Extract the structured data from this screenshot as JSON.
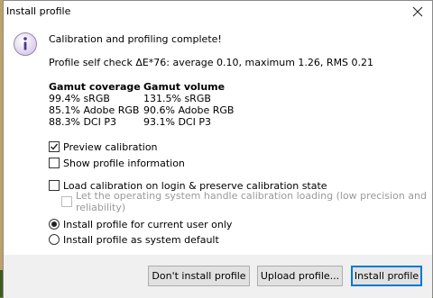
{
  "window": {
    "title": "Install profile"
  },
  "icons": {
    "info": "info-icon",
    "close": "close-icon"
  },
  "message": {
    "headline": "Calibration and profiling complete!",
    "self_check": "Profile self check ΔE*76: average 0.10, maximum 1.26, RMS 0.21"
  },
  "gamut": {
    "coverage": {
      "label": "Gamut coverage",
      "items": [
        "99.4% sRGB",
        "85.1% Adobe RGB",
        "88.3% DCI P3"
      ]
    },
    "volume": {
      "label": "Gamut volume",
      "items": [
        "131.5% sRGB",
        "90.6% Adobe RGB",
        "93.1% DCI P3"
      ]
    }
  },
  "options": {
    "preview_calibration": {
      "label": "Preview calibration",
      "checked": true
    },
    "show_profile_information": {
      "label": "Show profile information",
      "checked": false
    },
    "load_calibration": {
      "label": "Load calibration on login & preserve calibration state",
      "checked": false
    },
    "os_calibration_loading": {
      "label": "Let the operating system handle calibration loading (low precision and reliability)",
      "checked": false,
      "disabled": true
    }
  },
  "install_scope": {
    "current_user": {
      "label": "Install profile for current user only",
      "selected": true
    },
    "system_default": {
      "label": "Install profile as system default",
      "selected": false
    }
  },
  "buttons": {
    "dont_install": "Don't install profile",
    "upload": "Upload profile...",
    "install": "Install profile"
  },
  "colors": {
    "focus_accent": "#0078d7",
    "footer_background": "#f0f0f0",
    "info_icon_fill": "#e8dff0",
    "info_icon_border": "#9a86b3"
  }
}
